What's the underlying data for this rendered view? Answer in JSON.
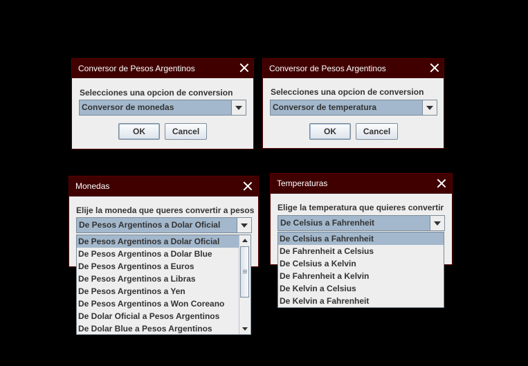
{
  "dialog_main_1": {
    "title": "Conversor de Pesos Argentinos",
    "prompt": "Selecciones una opcion de conversion",
    "selected": "Conversor de monedas",
    "ok": "OK",
    "cancel": "Cancel"
  },
  "dialog_main_2": {
    "title": "Conversor de Pesos Argentinos",
    "prompt": "Selecciones una opcion de conversion",
    "selected": "Conversor de temperatura",
    "ok": "OK",
    "cancel": "Cancel"
  },
  "dialog_monedas": {
    "title": "Monedas",
    "prompt": "Elije la moneda que queres convertir a pesos",
    "selected": "De Pesos Argentinos a Dolar Oficial",
    "options": [
      "De Pesos Argentinos a Dolar Oficial",
      "De Pesos Argentinos a Dolar Blue",
      "De Pesos Argentinos a Euros",
      "De Pesos Argentinos a Libras",
      "De Pesos Argentinos a Yen",
      "De Pesos Argentinos a Won Coreano",
      "De Dolar Oficial a Pesos Argentinos",
      "De Dolar Blue a Pesos Argentinos"
    ]
  },
  "dialog_temperaturas": {
    "title": "Temperaturas",
    "prompt": "Elige la temperatura que quieres convertir",
    "selected": "De Celsius a Fahrenheit",
    "options": [
      "De Celsius a Fahrenheit",
      "De Fahrenheit a Celsius",
      "De Celsius a Kelvin",
      "De Fahrenheit a Kelvin",
      "De Kelvin a Celsius",
      "De Kelvin a Fahrenheit"
    ]
  },
  "colors": {
    "title_bar": "#400000",
    "selection": "#a3b8cc",
    "dialog_bg": "#eeeeee",
    "desktop_bg": "#000000"
  }
}
